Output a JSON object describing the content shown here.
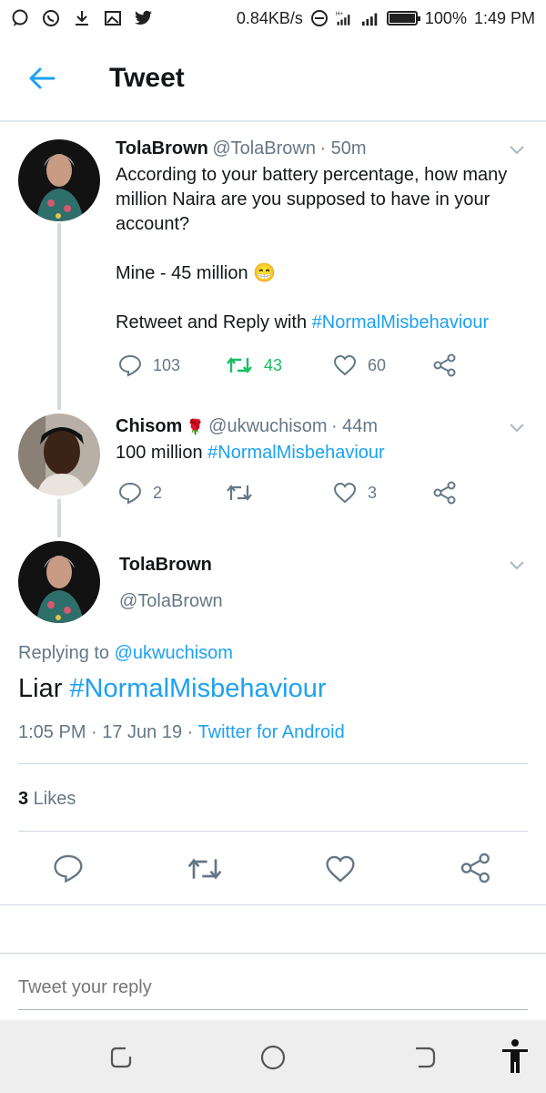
{
  "status": {
    "left_icons": [
      "chat-icon",
      "whatsapp-icon",
      "download-icon",
      "gallery-icon",
      "twitter-icon"
    ],
    "speed": "0.84KB/s",
    "battery": "100%",
    "battery_level": 1.0,
    "time": "1:49 PM"
  },
  "header": {
    "title": "Tweet"
  },
  "thread": [
    {
      "name": "TolaBrown",
      "handle": "@TolaBrown",
      "time": "· 50m",
      "lines": [
        "According to your battery percentage, how many",
        "million Naira are you supposed to have in your",
        "account?"
      ],
      "line2_prefix": "Mine  - 45 million",
      "line2_emoji": "😁",
      "line3_prefix": "Retweet and Reply with ",
      "line3_tag": "#NormalMisbehaviour",
      "replies": "103",
      "retweets": "43",
      "likes": "60"
    },
    {
      "name": "Chisom",
      "emoji": "🌹",
      "handle": "@ukwuchisom",
      "time": "· 44m",
      "text_prefix": "100 million ",
      "text_tag": "#NormalMisbehaviour",
      "replies": "2",
      "retweets": "",
      "likes": "3"
    }
  ],
  "main": {
    "name": "TolaBrown",
    "handle": "@TolaBrown",
    "replying_label": "Replying to ",
    "replying_to": "@ukwuchisom",
    "text_prefix": "Liar ",
    "text_tag": "#NormalMisbehaviour",
    "timestamp": "1:05 PM · 17 Jun 19 · ",
    "source": "Twitter for Android",
    "likes_count": "3",
    "likes_label": " Likes"
  },
  "reply_box": {
    "placeholder": "Tweet your reply"
  },
  "colors": {
    "accent": "#1da1f2",
    "retweet": "#17bf63",
    "muted": "#657786"
  }
}
